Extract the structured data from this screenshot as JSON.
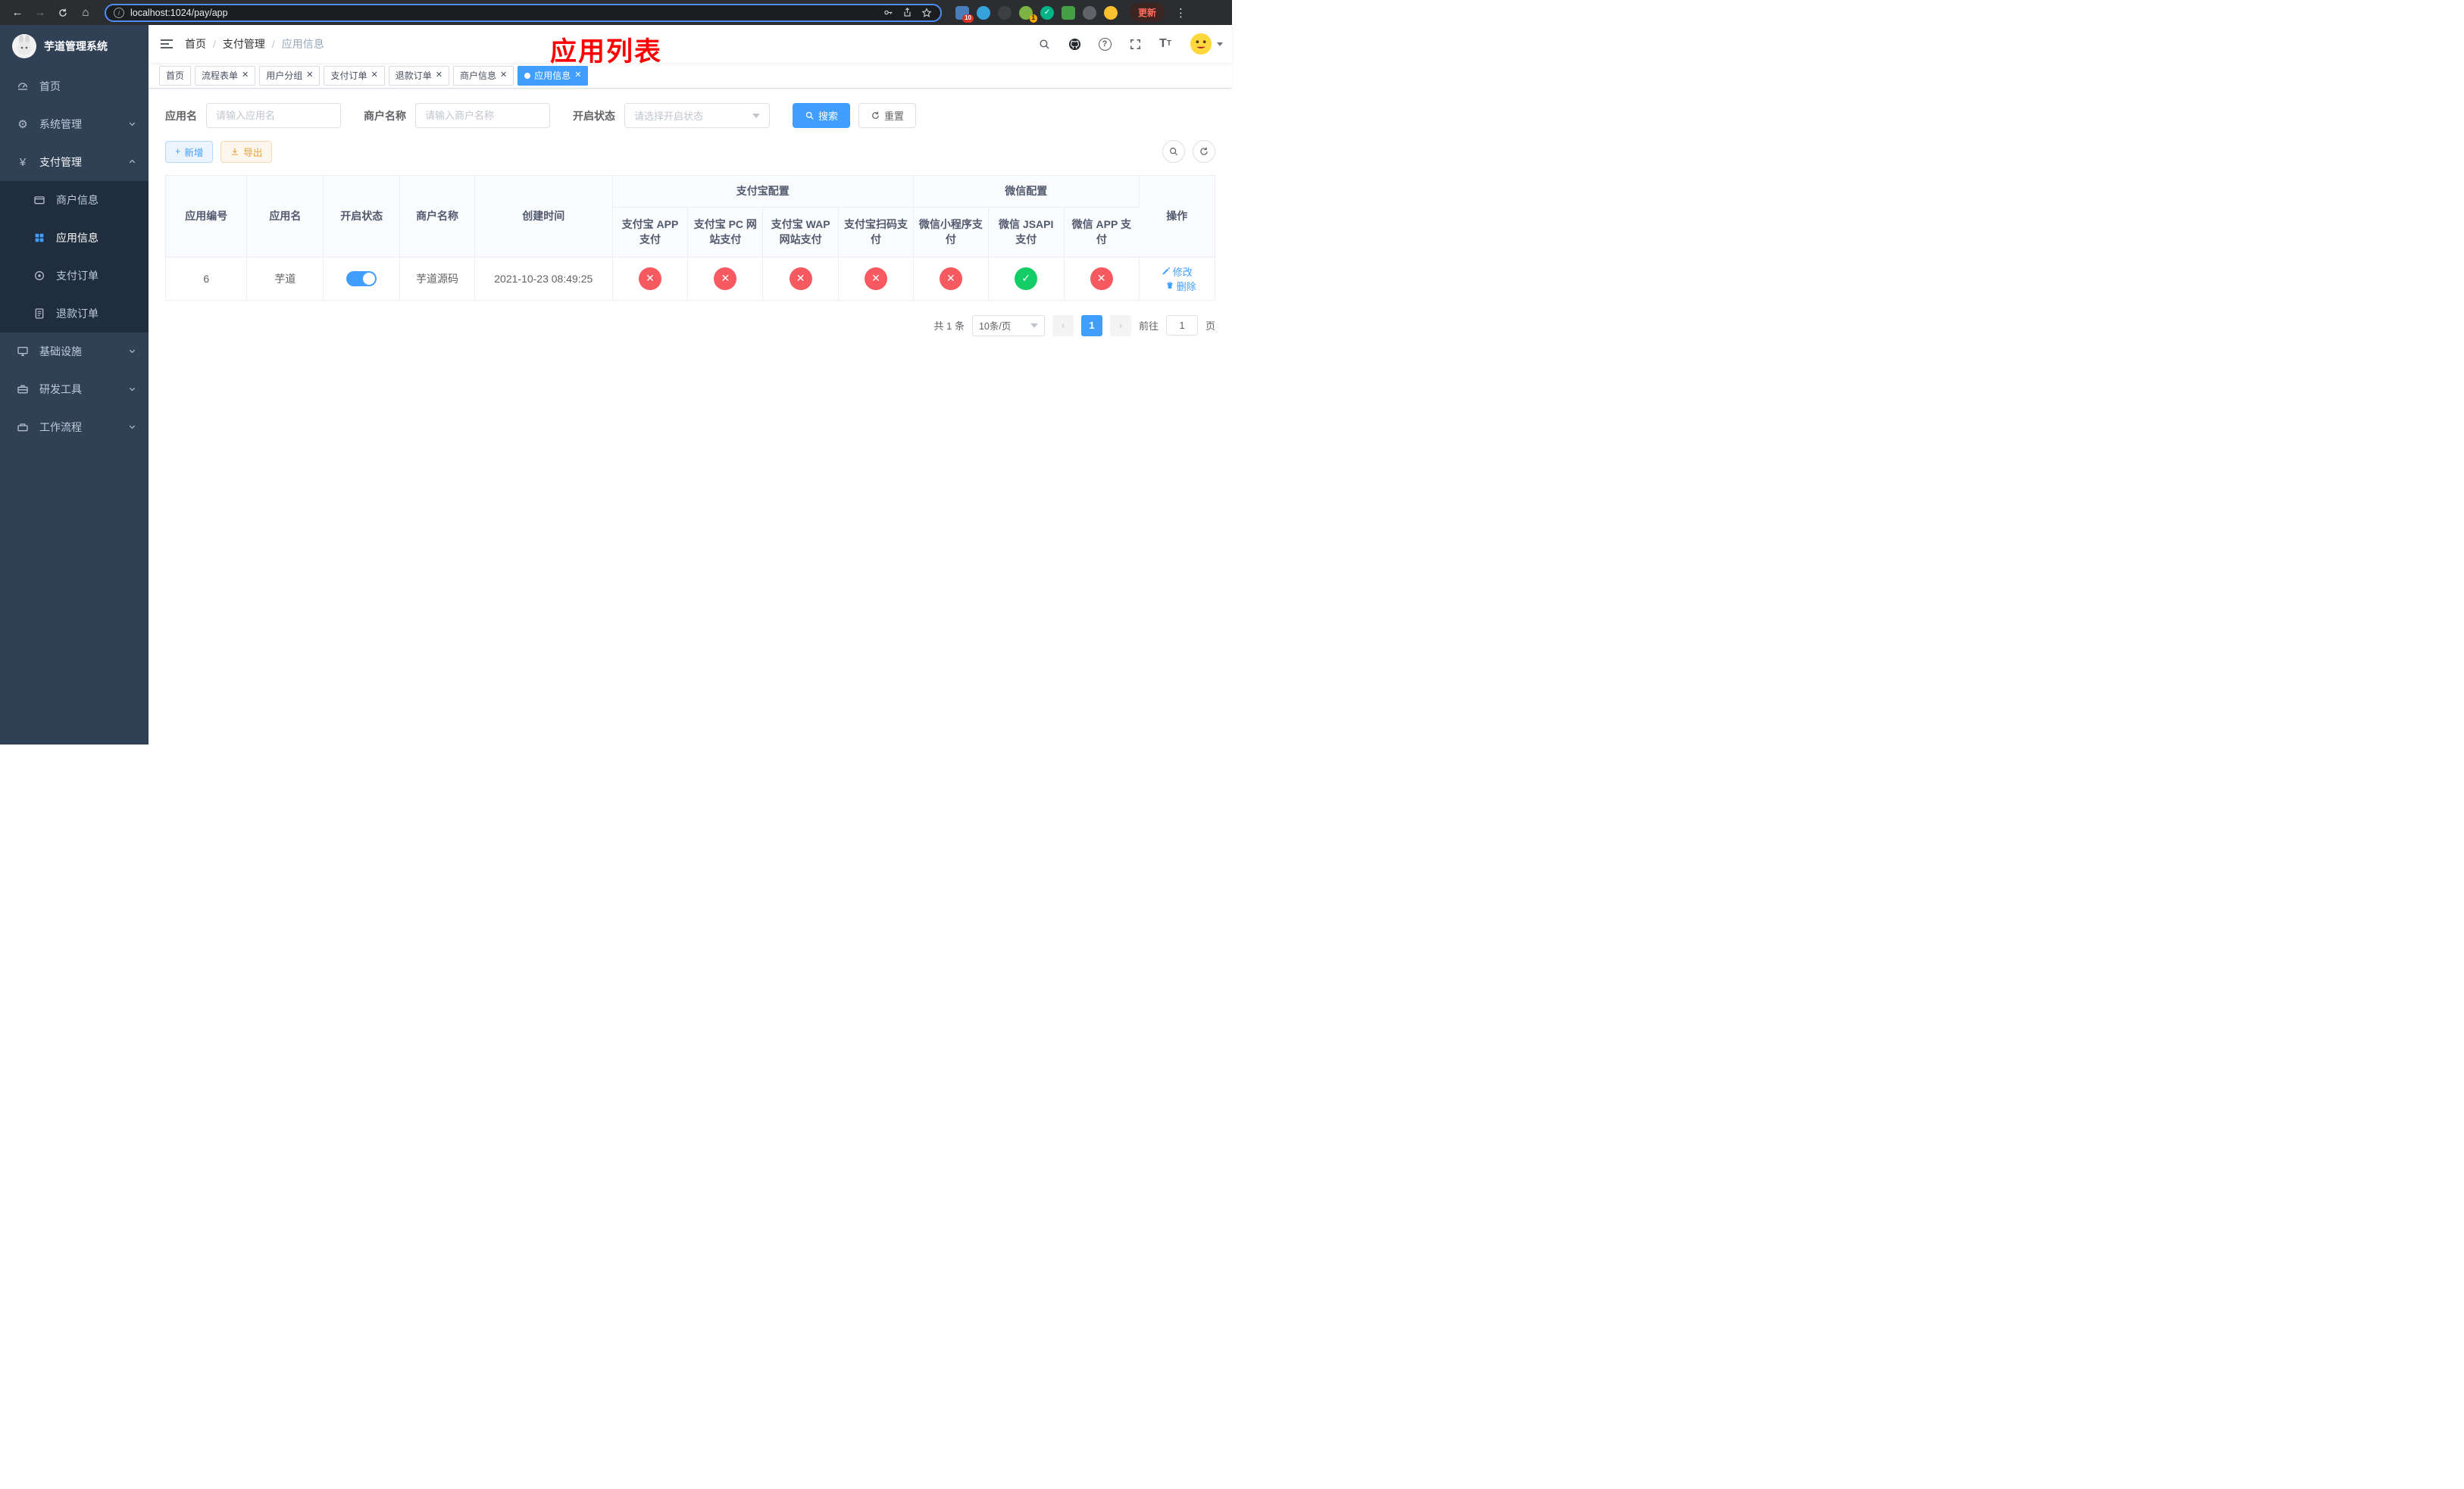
{
  "browser": {
    "url": "localhost:1024/pay/app",
    "update_label": "更新",
    "ext_badge_1": "10",
    "ext_badge_2": "1"
  },
  "annotation": "应用列表",
  "sidebar": {
    "title": "芋道管理系统",
    "items": [
      {
        "label": "首页"
      },
      {
        "label": "系统管理"
      },
      {
        "label": "支付管理"
      },
      {
        "label": "基础设施"
      },
      {
        "label": "研发工具"
      },
      {
        "label": "工作流程"
      }
    ],
    "payment_children": [
      {
        "label": "商户信息"
      },
      {
        "label": "应用信息"
      },
      {
        "label": "支付订单"
      },
      {
        "label": "退款订单"
      }
    ]
  },
  "breadcrumb": {
    "items": [
      "首页",
      "支付管理",
      "应用信息"
    ]
  },
  "tabs": [
    {
      "label": "首页"
    },
    {
      "label": "流程表单"
    },
    {
      "label": "用户分组"
    },
    {
      "label": "支付订单"
    },
    {
      "label": "退款订单"
    },
    {
      "label": "商户信息"
    },
    {
      "label": "应用信息"
    }
  ],
  "filters": {
    "app_name_label": "应用名",
    "app_name_placeholder": "请输入应用名",
    "merchant_label": "商户名称",
    "merchant_placeholder": "请输入商户名称",
    "status_label": "开启状态",
    "status_placeholder": "请选择开启状态",
    "search_label": "搜索",
    "reset_label": "重置"
  },
  "toolbar": {
    "add_label": "新增",
    "export_label": "导出"
  },
  "table": {
    "headers": {
      "app_id": "应用编号",
      "app_name": "应用名",
      "status": "开启状态",
      "merchant": "商户名称",
      "created": "创建时间",
      "alipay_group": "支付宝配置",
      "wechat_group": "微信配置",
      "alipay_app": "支付宝 APP 支付",
      "alipay_pc": "支付宝 PC 网站支付",
      "alipay_wap": "支付宝 WAP 网站支付",
      "alipay_qr": "支付宝扫码支付",
      "wechat_mini": "微信小程序支付",
      "wechat_jsapi": "微信 JSAPI 支付",
      "wechat_app": "微信 APP 支付",
      "actions": "操作"
    },
    "rows": [
      {
        "app_id": "6",
        "app_name": "芋道",
        "status_on": true,
        "merchant": "芋道源码",
        "created": "2021-10-23 08:49:25",
        "configs": [
          "x",
          "x",
          "x",
          "x",
          "x",
          "check",
          "x"
        ],
        "edit_label": "修改",
        "delete_label": "删除"
      }
    ]
  },
  "pagination": {
    "total": "共 1 条",
    "page_size": "10条/页",
    "current_page": "1",
    "goto_prefix": "前往",
    "goto_value": "1",
    "goto_suffix": "页"
  }
}
